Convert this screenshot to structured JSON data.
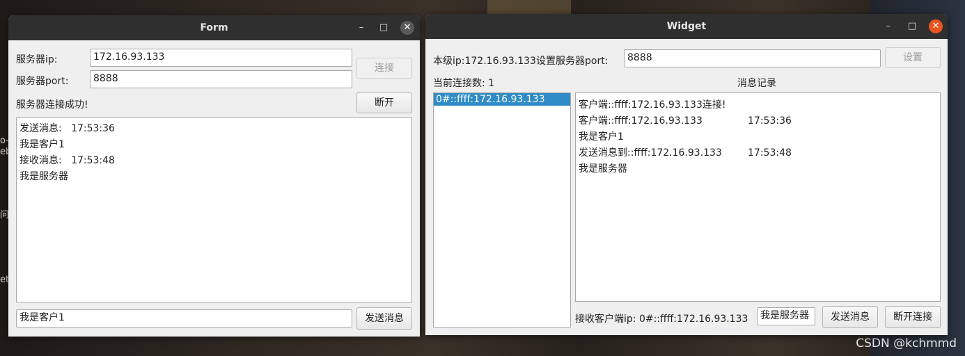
{
  "watermark": "CSDN @kchmmd",
  "desktop_fragments": [
    "o-",
    "eb",
    "问",
    "et"
  ],
  "form_window": {
    "title": "Form",
    "server_ip_label": "服务器ip:",
    "server_ip_value": "172.16.93.133",
    "server_port_label": "服务器port:",
    "server_port_value": "8888",
    "connect_button": "连接",
    "status_text": "服务器连接成功!",
    "disconnect_button": "断开",
    "messages": [
      "发送消息:   17:53:36",
      "我是客户1",
      "接收消息:   17:53:48",
      "我是服务器"
    ],
    "message_input": "我是客户1",
    "send_button": "发送消息",
    "minimize_icon": "minimize-icon",
    "maximize_icon": "maximize-icon",
    "close_icon": "close-icon"
  },
  "widget_window": {
    "title": "Widget",
    "local_ip_label": "本级ip:172.16.93.133",
    "set_port_label": "设置服务器port:",
    "port_value": "8888",
    "set_button": "设置",
    "connection_count_label": "当前连接数: 1",
    "message_log_title": "消息记录",
    "clients": [
      "0#::ffff:172.16.93.133"
    ],
    "log": [
      {
        "text": "客户端::ffff:172.16.93.133连接!",
        "time": ""
      },
      {
        "text": "客户端::ffff:172.16.93.133",
        "time": "17:53:36"
      },
      {
        "text": "我是客户1",
        "time": ""
      },
      {
        "text": "发送消息到::ffff:172.16.93.133",
        "time": "17:53:48"
      },
      {
        "text": "我是服务器",
        "time": ""
      }
    ],
    "receiver_ip_label": "接收客户端ip: 0#::ffff:172.16.93.133",
    "message_input": "我是服务器",
    "send_button": "发送消息",
    "disconnect_button": "断开连接",
    "accent_close_color": "#e95420",
    "selection_color": "#308cc6"
  }
}
